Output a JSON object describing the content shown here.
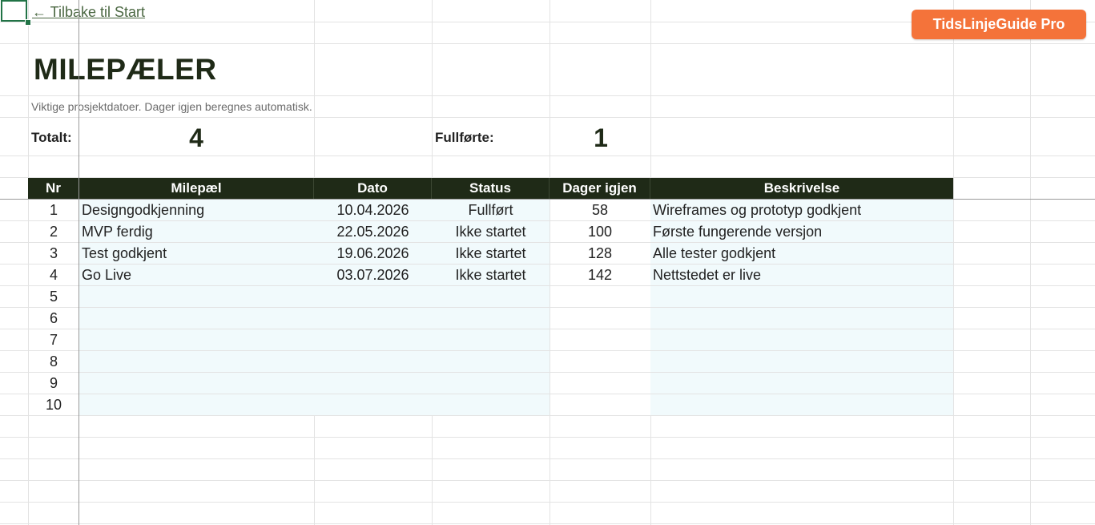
{
  "nav": {
    "back_label": "← Tilbake til Start"
  },
  "brand": {
    "label": "TidsLinjeGuide Pro",
    "color": "#f4733a"
  },
  "page": {
    "title": "MILEPÆLER",
    "subtitle": "Viktige prosjektdatoer. Dager igjen beregnes automatisk."
  },
  "stats": {
    "total_label": "Totalt:",
    "total_value": "4",
    "done_label": "Fullførte:",
    "done_value": "1"
  },
  "table": {
    "header_color": "#1f2a17",
    "columns": [
      "Nr",
      "Milepæl",
      "Dato",
      "Status",
      "Dager igjen",
      "Beskrivelse"
    ],
    "rows": [
      [
        "1",
        "Designgodkjenning",
        "10.04.2026",
        "Fullført",
        "58",
        "Wireframes og prototyp godkjent"
      ],
      [
        "2",
        "MVP ferdig",
        "22.05.2026",
        "Ikke startet",
        "100",
        "Første fungerende versjon"
      ],
      [
        "3",
        "Test godkjent",
        "19.06.2026",
        "Ikke startet",
        "128",
        "Alle tester godkjent"
      ],
      [
        "4",
        "Go Live",
        "03.07.2026",
        "Ikke startet",
        "142",
        "Nettstedet er live"
      ],
      [
        "5",
        "",
        "",
        "",
        "",
        ""
      ],
      [
        "6",
        "",
        "",
        "",
        "",
        ""
      ],
      [
        "7",
        "",
        "",
        "",
        "",
        ""
      ],
      [
        "8",
        "",
        "",
        "",
        "",
        ""
      ],
      [
        "9",
        "",
        "",
        "",
        "",
        ""
      ],
      [
        "10",
        "",
        "",
        "",
        "",
        ""
      ]
    ]
  }
}
